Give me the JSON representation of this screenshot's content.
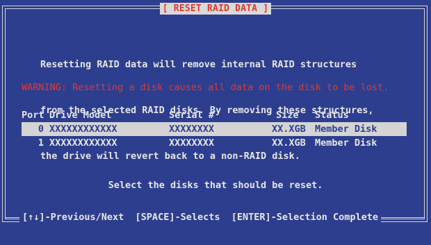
{
  "title": "[ RESET RAID DATA ]",
  "info_lines": [
    "Resetting RAID data will remove internal RAID structures",
    "from the selected RAID disks. By removing these structures,",
    "the drive will revert back to a non-RAID disk."
  ],
  "warning": "WARNING: Resetting a disk causes all data on the disk to be lost.",
  "table": {
    "headers": {
      "port": "Port",
      "model": "Drive Model",
      "serial": "Serial #",
      "size": "Size",
      "status": "Status"
    },
    "rows": [
      {
        "port": "0",
        "model": "XXXXXXXXXXXX",
        "serial": "XXXXXXXX",
        "size": "XX.XGB",
        "status": "Member Disk",
        "selected": true
      },
      {
        "port": "1",
        "model": "XXXXXXXXXXXX",
        "serial": "XXXXXXXX",
        "size": "XX.XGB",
        "status": "Member Disk",
        "selected": false
      }
    ]
  },
  "prompt": "Select the disks that should be reset.",
  "footer": "[↑↓]-Previous/Next  [SPACE]-Selects  [ENTER]-Selection Complete",
  "colors": {
    "background": "#2d3e8f",
    "text": "#e6e6e6",
    "warning": "#e03a2e",
    "highlight": "#d4d4d4"
  }
}
